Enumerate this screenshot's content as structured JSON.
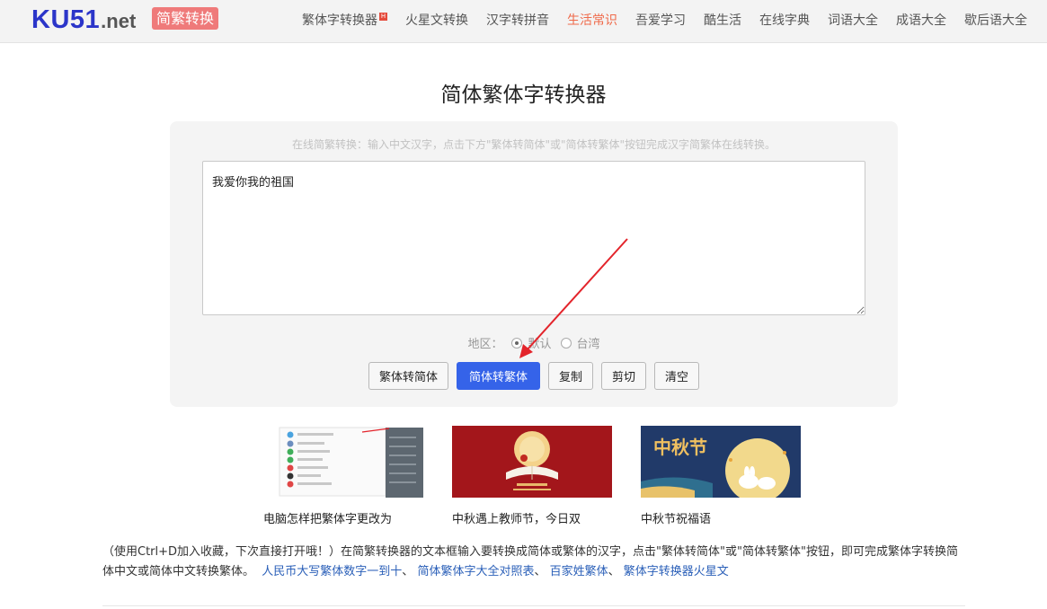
{
  "header": {
    "logo_main": "KU51",
    "logo_tld": ".net",
    "badge": "简繁转换",
    "nav": [
      {
        "label": "繁体字转换器",
        "hot": true,
        "active": false
      },
      {
        "label": "火星文转换",
        "active": false
      },
      {
        "label": "汉字转拼音",
        "active": false
      },
      {
        "label": "生活常识",
        "active": true
      },
      {
        "label": "吾爱学习",
        "active": false
      },
      {
        "label": "酷生活",
        "active": false
      },
      {
        "label": "在线字典",
        "active": false
      },
      {
        "label": "词语大全",
        "active": false
      },
      {
        "label": "成语大全",
        "active": false
      },
      {
        "label": "歇后语大全",
        "active": false
      }
    ],
    "hot_badge": "H"
  },
  "main": {
    "title": "简体繁体字转换器",
    "hint": "在线简繁转换：输入中文汉字，点击下方\"繁体转简体\"或\"简体转繁体\"按钮完成汉字简繁体在线转换。",
    "textarea_value": "我爱你我的祖国",
    "region": {
      "label": "地区：",
      "options": [
        {
          "label": "默认",
          "checked": true
        },
        {
          "label": "台湾",
          "checked": false
        }
      ]
    },
    "buttons": {
      "to_simplified": "繁体转简体",
      "to_traditional": "简体转繁体",
      "copy": "复制",
      "cut": "剪切",
      "clear": "清空"
    }
  },
  "cards": [
    {
      "caption": "电脑怎样把繁体字更改为"
    },
    {
      "caption": "中秋遇上教师节，今日双"
    },
    {
      "caption": "中秋节祝福语"
    }
  ],
  "thumb3_text": "中秋节",
  "description": {
    "text": "（使用Ctrl+D加入收藏，下次直接打开哦！）在简繁转换器的文本框输入要转换成简体或繁体的汉字，点击\"繁体转简体\"或\"简体转繁体\"按钮，即可完成繁体字转换简体中文或简体中文转换繁体。",
    "links": [
      "人民币大写繁体数字一到十",
      "简体繁体字大全对照表",
      "百家姓繁体",
      "繁体字转换器火星文"
    ]
  },
  "colors": {
    "logo_blue": "#2b35c9",
    "badge_bg": "#ef7a7a",
    "nav_active": "#ef6a4a",
    "primary_button": "#3563e9",
    "link": "#2a5fb8",
    "arrow": "#e3242b"
  }
}
